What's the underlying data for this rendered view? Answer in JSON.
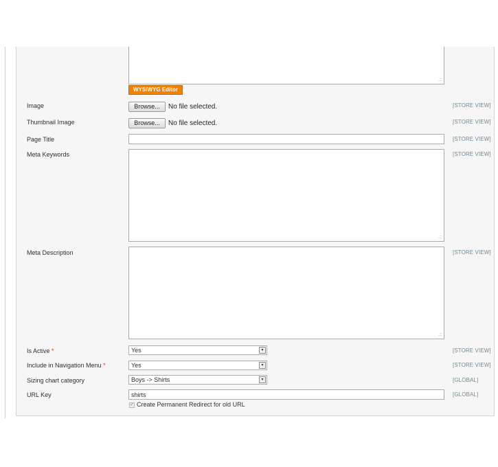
{
  "wysiwyg_label": "WYSIWYG Editor",
  "browse_label": "Browse...",
  "no_file_text": "No file selected.",
  "fields": {
    "image": {
      "label": "Image",
      "scope": "[STORE VIEW]"
    },
    "thumbnail": {
      "label": "Thumbnail Image",
      "scope": "[STORE VIEW]"
    },
    "page_title": {
      "label": "Page Title",
      "scope": "[STORE VIEW]",
      "value": ""
    },
    "meta_keywords": {
      "label": "Meta Keywords",
      "scope": "[STORE VIEW]",
      "value": ""
    },
    "meta_description": {
      "label": "Meta Description",
      "scope": "[STORE VIEW]",
      "value": ""
    },
    "is_active": {
      "label": "Is Active",
      "required_mark": "*",
      "scope": "[STORE VIEW]",
      "value": "Yes"
    },
    "include_nav": {
      "label": "Include in Navigation Menu",
      "required_mark": "*",
      "scope": "[STORE VIEW]",
      "value": "Yes"
    },
    "sizing_chart": {
      "label": "Sizing chart category",
      "scope": "[GLOBAL]",
      "value": "Boys -> Shirts"
    },
    "url_key": {
      "label": "URL Key",
      "scope": "[GLOBAL]",
      "value": "shirts"
    }
  },
  "redirect_checkbox": {
    "label": "Create Permanent Redirect for old URL",
    "checked": true
  }
}
